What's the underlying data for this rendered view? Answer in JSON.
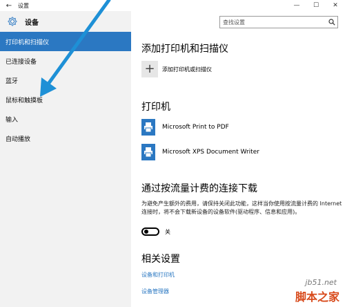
{
  "titlebar": {
    "back_glyph": "←",
    "title": "设置",
    "minimize": "—",
    "maximize": "☐",
    "close": "✕"
  },
  "sidebar": {
    "header_title": "设备",
    "items": [
      {
        "label": "打印机和扫描仪",
        "active": true
      },
      {
        "label": "已连接设备"
      },
      {
        "label": "蓝牙"
      },
      {
        "label": "鼠标和触摸板"
      },
      {
        "label": "输入"
      },
      {
        "label": "自动播放"
      }
    ]
  },
  "search": {
    "placeholder": "查找设置",
    "icon": "search-icon"
  },
  "main": {
    "add_section_title": "添加打印机和扫描仪",
    "add_button_glyph": "+",
    "add_button_label": "添加打印机或扫描仪",
    "printers_title": "打印机",
    "printers": [
      {
        "name": "Microsoft Print to PDF"
      },
      {
        "name": "Microsoft XPS Document Writer"
      }
    ],
    "metered_title": "通过按流量计费的连接下载",
    "metered_desc": "为避免产生额外的费用，请保持关闭此功能，这样当你使用按流量计费的 Internet 连接时，将不会下载新设备的设备软件(驱动程序、信息和应用)。",
    "metered_toggle_state": "关",
    "related_title": "相关设置",
    "related_links": [
      {
        "label": "设备和打印机"
      },
      {
        "label": "设备管理器"
      }
    ]
  },
  "colors": {
    "accent": "#2b78c2",
    "sidebar_bg": "#f2f2f2",
    "arrow": "#1e90d6"
  },
  "watermark": {
    "line1": "jb51.net",
    "line2": "脚本之家"
  }
}
